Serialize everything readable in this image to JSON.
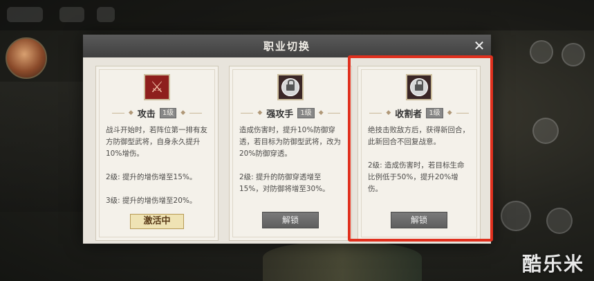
{
  "modal": {
    "title": "职业切换",
    "close_glyph": "✕"
  },
  "cards": [
    {
      "name": "攻击",
      "level": "1级",
      "icon": "sword-icon",
      "icon_color": "#8e1f1d",
      "locked": false,
      "desc": [
        "战斗开始时，若阵位第一排有友方防御型武将，自身永久提升10%增伤。",
        "2级: 提升的增伤增至15%。",
        "3级: 提升的增伤增至20%。"
      ],
      "status_label": "激活中"
    },
    {
      "name": "强攻手",
      "level": "1级",
      "icon": "lock-icon",
      "icon_color": "#3a2626",
      "locked": true,
      "desc": [
        "造成伤害时，提升10%防御穿透，若目标为防御型武将，改为20%防御穿透。",
        "2级: 提升的防御穿透增至15%，对防御将增至30%。"
      ],
      "button_label": "解锁"
    },
    {
      "name": "收割者",
      "level": "1级",
      "icon": "lock-icon",
      "icon_color": "#3a2626",
      "locked": true,
      "desc": [
        "绝技击败敌方后，获得新回合，此新回合不回复战意。",
        "2级: 造成伤害时，若目标生命比例低于50%，提升20%增伤。"
      ],
      "button_label": "解锁"
    }
  ],
  "highlight_color": "#e0301e",
  "watermark": "酷乐米"
}
